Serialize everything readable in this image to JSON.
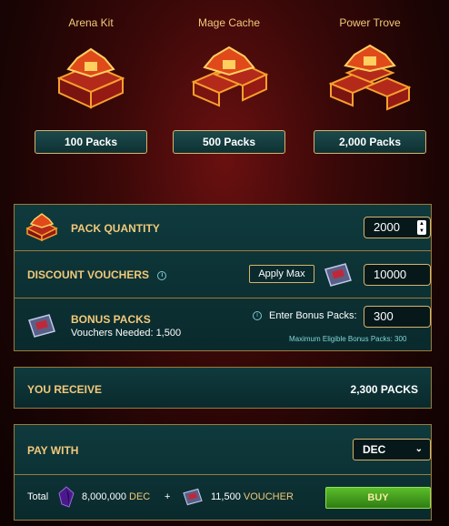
{
  "packs": [
    {
      "title": "Arena Kit",
      "button": "100 Packs"
    },
    {
      "title": "Mage Cache",
      "button": "500 Packs"
    },
    {
      "title": "Power Trove",
      "button": "2,000 Packs"
    }
  ],
  "quantity": {
    "label": "PACK QUANTITY",
    "value": "2000",
    "icon": "pack-icon"
  },
  "discount": {
    "label": "DISCOUNT VOUCHERS",
    "apply_max": "Apply Max",
    "value": "10000",
    "icon": "voucher-icon"
  },
  "bonus": {
    "label": "BONUS PACKS",
    "vouchers_needed": "Vouchers Needed: 1,500",
    "enter_label": "Enter Bonus Packs:",
    "value": "300",
    "max_eligible": "Maximum Eligible Bonus Packs: 300"
  },
  "receive": {
    "label": "YOU RECEIVE",
    "value": "2,300 PACKS"
  },
  "pay": {
    "label": "PAY WITH",
    "currency": "DEC",
    "total_label": "Total",
    "dec_amount": "8,000,000",
    "dec_unit": "DEC",
    "plus": "+",
    "voucher_amount": "11,500",
    "voucher_unit": "VOUCHER",
    "buy": "BUY"
  },
  "colors": {
    "accent_gold": "#d8b36a",
    "panel_teal": "#0f3a3d",
    "buy_green": "#4aa81f",
    "link_cyan": "#7fd6d6"
  }
}
